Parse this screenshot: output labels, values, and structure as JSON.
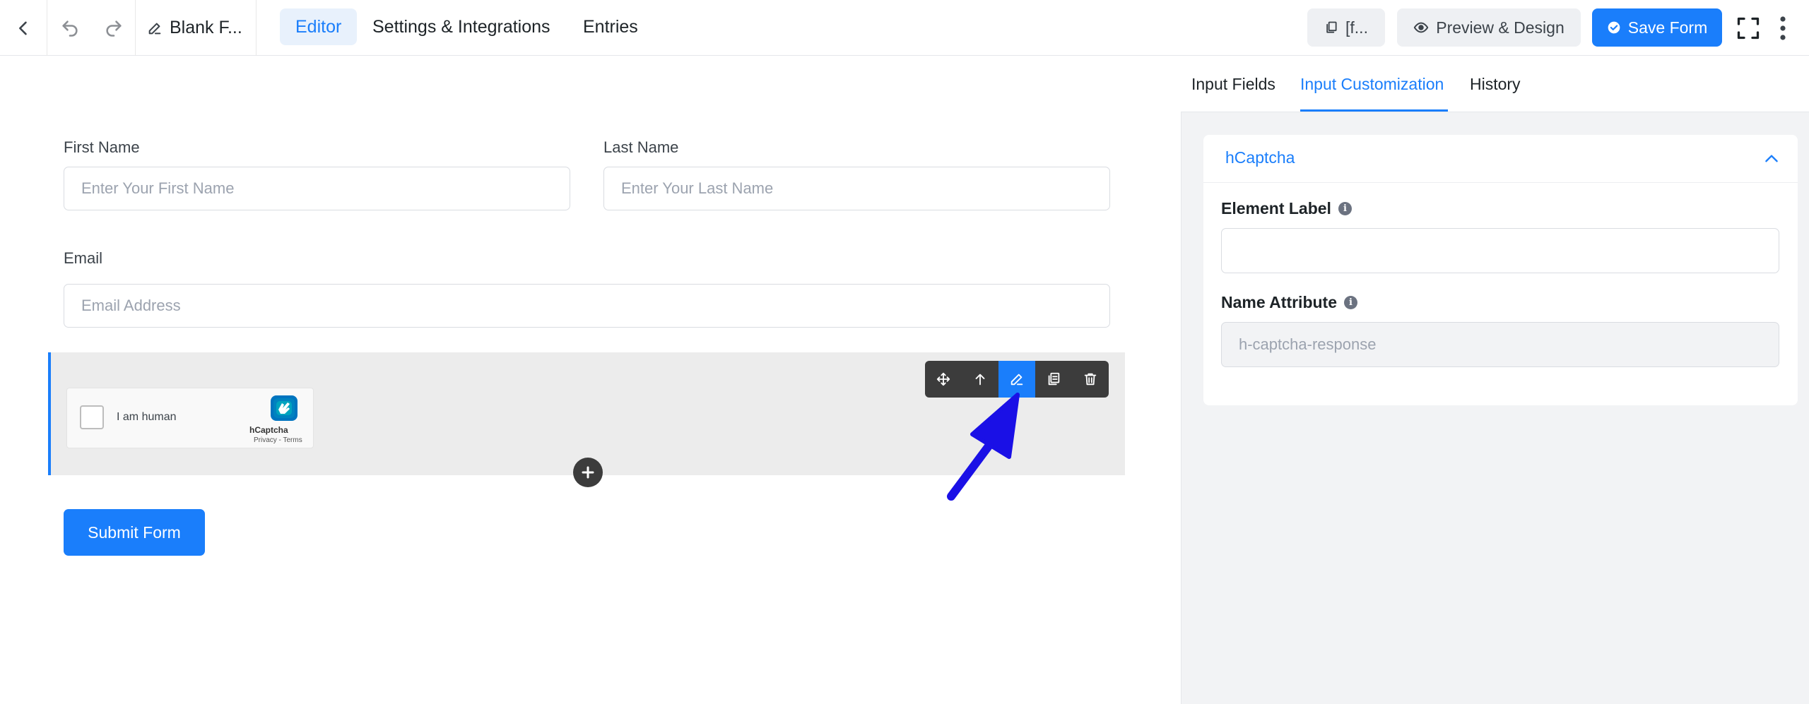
{
  "topbar": {
    "form_name": "Blank F...",
    "tabs": [
      {
        "label": "Editor",
        "active": true
      },
      {
        "label": "Settings & Integrations",
        "active": false
      },
      {
        "label": "Entries",
        "active": false
      }
    ],
    "shortcode_label": "[f...",
    "preview_label": "Preview & Design",
    "save_label": "Save Form"
  },
  "form": {
    "first_name": {
      "label": "First Name",
      "placeholder": "Enter Your First Name"
    },
    "last_name": {
      "label": "Last Name",
      "placeholder": "Enter Your Last Name"
    },
    "email": {
      "label": "Email",
      "placeholder": "Email Address"
    },
    "captcha": {
      "text": "I am human",
      "brand": "hCaptcha",
      "links": "Privacy - Terms"
    },
    "submit_label": "Submit Form"
  },
  "panel": {
    "tabs": [
      {
        "label": "Input Fields",
        "active": false
      },
      {
        "label": "Input Customization",
        "active": true
      },
      {
        "label": "History",
        "active": false
      }
    ],
    "section_title": "hCaptcha",
    "element_label": {
      "label": "Element Label",
      "value": ""
    },
    "name_attribute": {
      "label": "Name Attribute",
      "value": "h-captcha-response"
    }
  },
  "colors": {
    "accent": "#1a7efb",
    "annotation_arrow": "#1a10e6"
  }
}
